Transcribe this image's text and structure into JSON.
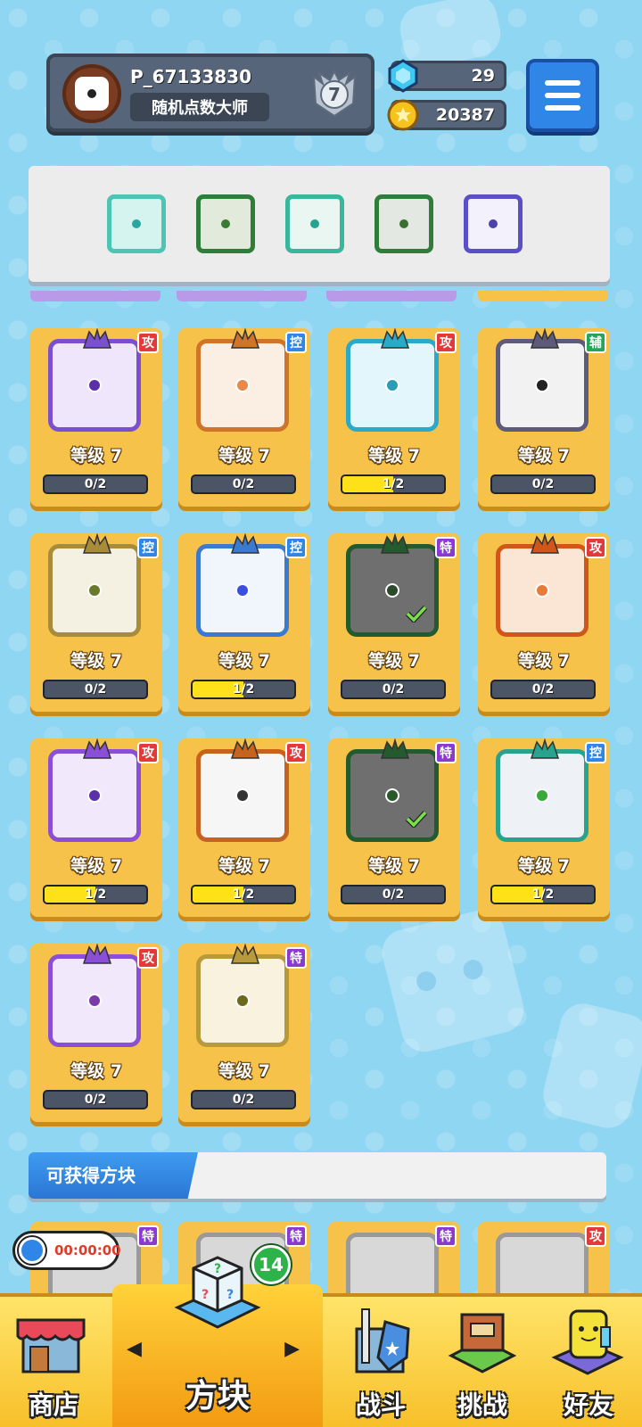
{
  "player": {
    "username": "P_67133830",
    "title": "随机点数大师",
    "rank": "7"
  },
  "currency": {
    "gems": "29",
    "coins": "20387"
  },
  "deck": [
    {
      "icon": "wind-dice-icon",
      "frame": "#4ec4b4",
      "bg": "#d6f4ef",
      "dot": "#2aa5a0"
    },
    {
      "icon": "wild-dragon-dice-icon",
      "frame": "#2e7d3a",
      "bg": "#e2eadc",
      "dot": "#3a7a32"
    },
    {
      "icon": "teal-dice-icon",
      "frame": "#39b79c",
      "bg": "#e9f6f2",
      "dot": "#26a38e"
    },
    {
      "icon": "pentagram-dragon-dice-icon",
      "frame": "#2e7d3a",
      "bg": "#e4e8e2",
      "dot": "#3a6e32"
    },
    {
      "icon": "hands-dice-icon",
      "frame": "#5a4fc7",
      "bg": "#f3f1fb",
      "dot": "#4b43a8"
    }
  ],
  "cards": [
    {
      "level": "等级 7",
      "progress": "0/2",
      "fill": 0,
      "tag": "攻",
      "tagColor": "#e23a3a",
      "frame": "#7a4fd0",
      "bg": "#efe6fb",
      "dot": "#5a2fa8",
      "checked": false,
      "icon": "purple-rune-dice-icon"
    },
    {
      "level": "等级 7",
      "progress": "0/2",
      "fill": 0,
      "tag": "控",
      "tagColor": "#2f86e6",
      "frame": "#d0742a",
      "bg": "#fbeee2",
      "dot": "#e8884a",
      "checked": false,
      "icon": "sand-dice-icon"
    },
    {
      "level": "等级 7",
      "progress": "1/2",
      "fill": 0.5,
      "tag": "攻",
      "tagColor": "#e23a3a",
      "frame": "#2aa9c8",
      "bg": "#e2f6fb",
      "dot": "#2a9cb8",
      "checked": false,
      "icon": "ice-trident-dice-icon"
    },
    {
      "level": "等级 7",
      "progress": "0/2",
      "fill": 0,
      "tag": "辅",
      "tagColor": "#27a35a",
      "frame": "#5e5a7a",
      "bg": "#f2f2f2",
      "dot": "#222222",
      "checked": false,
      "icon": "jaw-dice-icon"
    },
    {
      "level": "等级 7",
      "progress": "0/2",
      "fill": 0,
      "tag": "控",
      "tagColor": "#2f86e6",
      "frame": "#a88c3a",
      "bg": "#f4f0e2",
      "dot": "#6b7a2a",
      "checked": false,
      "icon": "shield-dice-icon"
    },
    {
      "level": "等级 7",
      "progress": "1/2",
      "fill": 0.5,
      "tag": "控",
      "tagColor": "#2f86e6",
      "frame": "#3a7ad0",
      "bg": "#f1f6fd",
      "dot": "#3a4ee0",
      "checked": false,
      "icon": "snowflake-dice-icon"
    },
    {
      "level": "等级 7",
      "progress": "0/2",
      "fill": 0,
      "tag": "特",
      "tagColor": "#8a3ad0",
      "frame": "#235a2e",
      "bg": "#6f6f6f",
      "dot": "#2a4a2a",
      "checked": true,
      "icon": "pentagram-dragon-dice-icon"
    },
    {
      "level": "等级 7",
      "progress": "0/2",
      "fill": 0,
      "tag": "攻",
      "tagColor": "#e23a3a",
      "frame": "#d0561a",
      "bg": "#fbe6d6",
      "dot": "#e87a3a",
      "checked": false,
      "icon": "fire-swirl-dice-icon"
    },
    {
      "level": "等级 7",
      "progress": "1/2",
      "fill": 0.5,
      "tag": "攻",
      "tagColor": "#e23a3a",
      "frame": "#8a4fd6",
      "bg": "#f1e8fb",
      "dot": "#5a2fa8",
      "checked": false,
      "icon": "orbit-dice-icon"
    },
    {
      "level": "等级 7",
      "progress": "1/2",
      "fill": 0.5,
      "tag": "攻",
      "tagColor": "#e23a3a",
      "frame": "#c6631e",
      "bg": "#f6f6f6",
      "dot": "#333333",
      "checked": false,
      "icon": "gun-dice-icon"
    },
    {
      "level": "等级 7",
      "progress": "0/2",
      "fill": 0,
      "tag": "特",
      "tagColor": "#8a3ad0",
      "frame": "#235a2e",
      "bg": "#6f6f6f",
      "dot": "#2a5a2a",
      "checked": true,
      "icon": "wild-dragon-dice-icon"
    },
    {
      "level": "等级 7",
      "progress": "1/2",
      "fill": 0.5,
      "tag": "控",
      "tagColor": "#2f86e6",
      "frame": "#2aa38e",
      "bg": "#eef2f6",
      "dot": "#3aa83a",
      "checked": false,
      "icon": "wave-dice-icon"
    },
    {
      "level": "等级 7",
      "progress": "0/2",
      "fill": 0,
      "tag": "攻",
      "tagColor": "#e23a3a",
      "frame": "#8a4fd6",
      "bg": "#f1e8fb",
      "dot": "#7a3aa8",
      "checked": false,
      "icon": "star-dice-icon"
    },
    {
      "level": "等级 7",
      "progress": "0/2",
      "fill": 0,
      "tag": "特",
      "tagColor": "#8a3ad0",
      "frame": "#b89a3a",
      "bg": "#f8f2de",
      "dot": "#6b6a1a",
      "checked": false,
      "icon": "golden-sun-dice-icon"
    }
  ],
  "available": {
    "header": "可获得方块",
    "cards": [
      {
        "tag": "特",
        "tagColor": "#8a3ad0",
        "icon": "locked-dice-icon"
      },
      {
        "tag": "特",
        "tagColor": "#8a3ad0",
        "icon": "locked-dice-icon"
      },
      {
        "tag": "特",
        "tagColor": "#8a3ad0",
        "icon": "locked-sword-dice-icon"
      },
      {
        "tag": "攻",
        "tagColor": "#e23a3a",
        "icon": "locked-vortex-dice-icon"
      }
    ]
  },
  "timer": "00:00:00",
  "box_badge": "14",
  "nav": {
    "shop": "商店",
    "dice": "方块",
    "battle": "战斗",
    "challenge": "挑战",
    "friends": "好友"
  }
}
